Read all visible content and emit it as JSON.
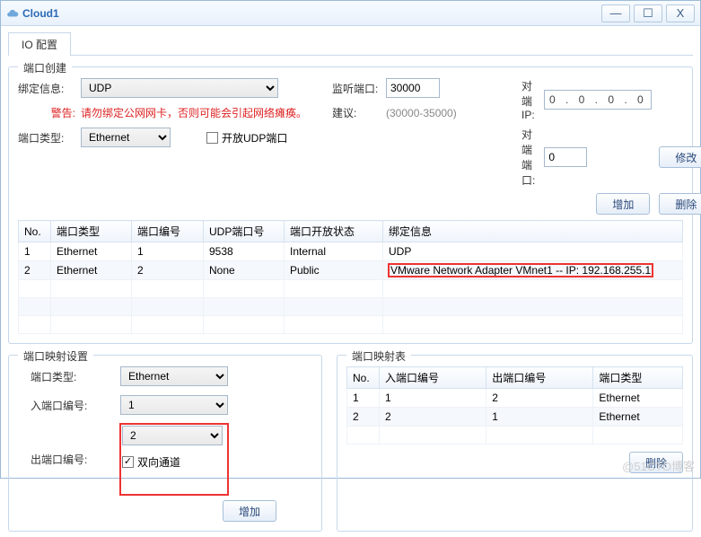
{
  "window": {
    "title": "Cloud1"
  },
  "titlebar_buttons": {
    "minimize": "—",
    "maximize": "☐",
    "close": "X"
  },
  "tabs": {
    "io_config": "IO 配置"
  },
  "port_create": {
    "legend": "端口创建",
    "bind_info_label": "绑定信息:",
    "bind_info_value": "UDP",
    "warning_label": "警告:",
    "warning_text": "请勿绑定公网网卡，否则可能会引起网络瘫痪。",
    "port_type_label": "端口类型:",
    "port_type_value": "Ethernet",
    "open_udp_label": "开放UDP端口",
    "listen_port_label": "监听端口:",
    "listen_port_value": "30000",
    "suggestion_label": "建议:",
    "suggestion_text": "(30000-35000)",
    "peer_ip_label": "对端IP:",
    "peer_ip_value": "0 . 0 . 0 . 0",
    "peer_port_label": "对端端口:",
    "peer_port_value": "0",
    "modify_btn": "修改",
    "add_btn": "增加",
    "delete_btn": "删除"
  },
  "port_table": {
    "headers": {
      "no": "No.",
      "port_type": "端口类型",
      "port_num": "端口编号",
      "udp_port": "UDP端口号",
      "open_state": "端口开放状态",
      "bind_info": "绑定信息"
    },
    "rows": [
      {
        "no": "1",
        "port_type": "Ethernet",
        "port_num": "1",
        "udp_port": "9538",
        "open_state": "Internal",
        "bind_info": "UDP"
      },
      {
        "no": "2",
        "port_type": "Ethernet",
        "port_num": "2",
        "udp_port": "None",
        "open_state": "Public",
        "bind_info": "VMware Network Adapter VMnet1 -- IP: 192.168.255.1"
      }
    ]
  },
  "port_map_settings": {
    "legend": "端口映射设置",
    "port_type_label": "端口类型:",
    "port_type_value": "Ethernet",
    "in_port_label": "入端口编号:",
    "in_port_value": "1",
    "out_port_label": "出端口编号:",
    "out_port_value": "2",
    "bidir_label": "双向通道",
    "bidir_checked": "✓",
    "add_btn": "增加"
  },
  "port_map_table": {
    "legend": "端口映射表",
    "headers": {
      "no": "No.",
      "in_port": "入端口编号",
      "out_port": "出端口编号",
      "port_type": "端口类型"
    },
    "rows": [
      {
        "no": "1",
        "in_port": "1",
        "out_port": "2",
        "port_type": "Ethernet"
      },
      {
        "no": "2",
        "in_port": "2",
        "out_port": "1",
        "port_type": "Ethernet"
      }
    ],
    "delete_btn": "删除"
  },
  "watermark": "@51CTO博客"
}
